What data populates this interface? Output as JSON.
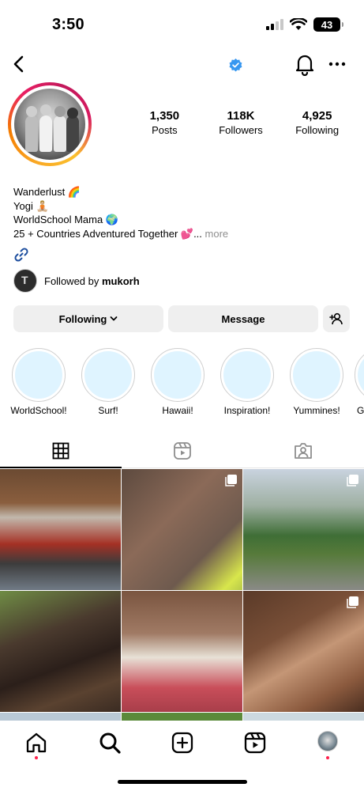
{
  "status_bar": {
    "time": "3:50",
    "battery": "43"
  },
  "profile": {
    "stats": [
      {
        "value": "1,350",
        "label": "Posts"
      },
      {
        "value": "118K",
        "label": "Followers"
      },
      {
        "value": "4,925",
        "label": "Following"
      }
    ],
    "bio_lines": [
      "Wanderlust 🌈",
      "Yogi 🧘🏼",
      "WorldSchool Mama 🌍",
      "25 + Countries Adventured Together 💕..."
    ],
    "bio_more": "more",
    "followed_by_prefix": "Followed by",
    "followed_by_user": "mukorh"
  },
  "actions": {
    "following_label": "Following",
    "message_label": "Message"
  },
  "highlights": [
    {
      "label": "WorldSchool!"
    },
    {
      "label": "Surf!"
    },
    {
      "label": "Hawaii!"
    },
    {
      "label": "Inspiration!"
    },
    {
      "label": "Yummines!"
    },
    {
      "label": "G"
    }
  ],
  "icons": {
    "back": "chevron-left-icon",
    "verified": "verified-badge-icon",
    "notifications": "bell-icon",
    "more": "more-horizontal-icon",
    "link": "link-icon",
    "add_user": "add-user-icon",
    "tab_grid": "grid-icon",
    "tab_reels": "reels-icon",
    "tab_tagged": "tagged-icon",
    "nav": [
      "home-icon",
      "search-icon",
      "create-icon",
      "reels-icon",
      "profile-avatar"
    ]
  },
  "colors": {
    "verified": "#3797f0",
    "highlight_fill": "#dff4ff",
    "notification_dot": "#ff1f4b",
    "button_bg": "#efefef"
  }
}
